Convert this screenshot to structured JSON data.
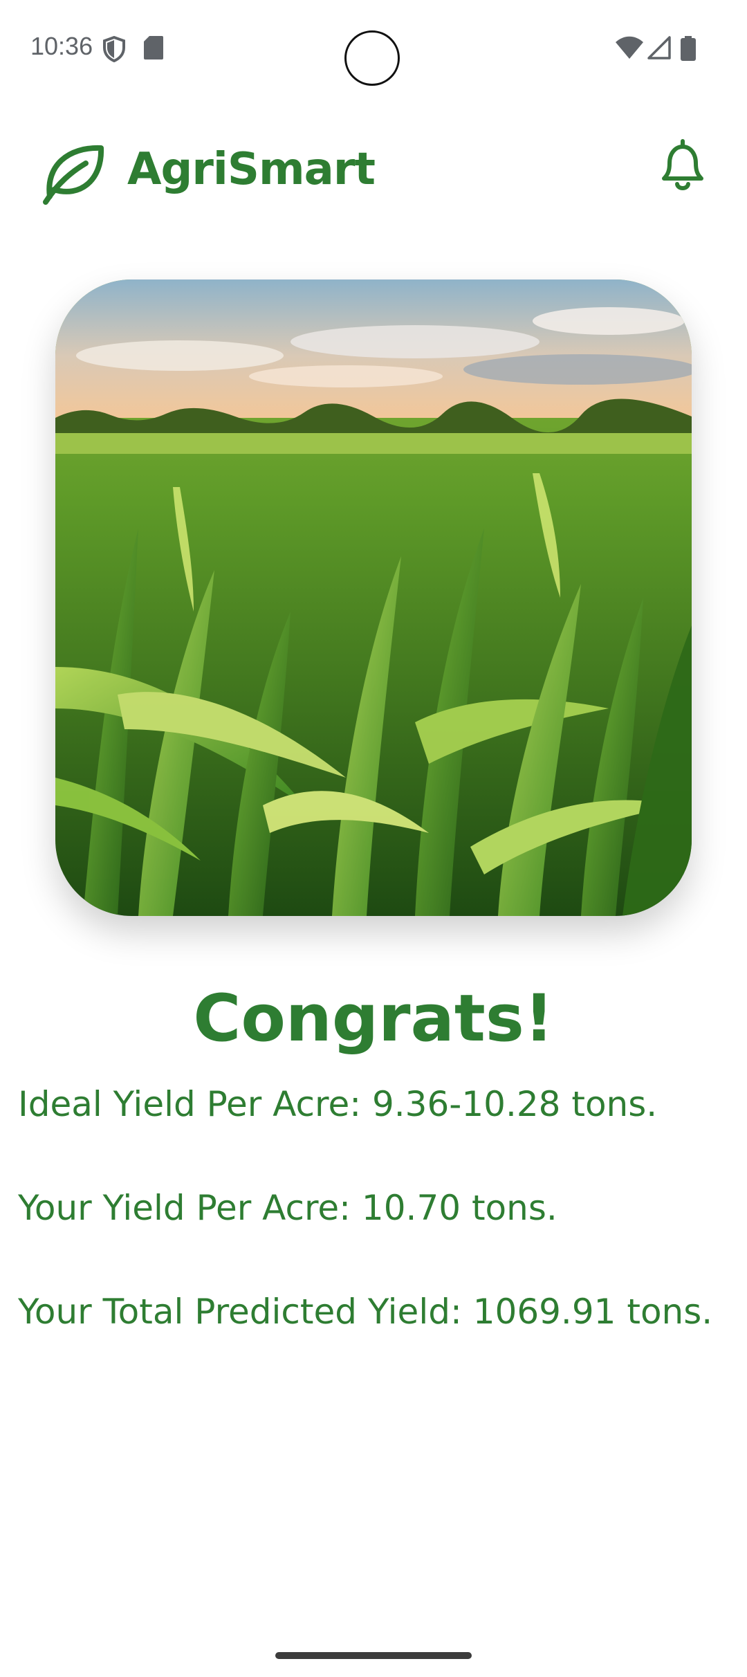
{
  "status_bar": {
    "time": "10:36"
  },
  "app_bar": {
    "title": "AgriSmart",
    "logo_icon": "leaf-icon",
    "notification_icon": "bell-icon"
  },
  "hero_image": {
    "icon": "corn-field-image"
  },
  "result": {
    "heading": "Congrats!",
    "ideal_yield": "Ideal Yield Per Acre: 9.36-10.28 tons.",
    "your_yield": "Your Yield Per Acre: 10.70 tons.",
    "total_yield": "Your Total Predicted Yield: 1069.91 tons."
  },
  "colors": {
    "primary": "#2e7d32",
    "background": "#ffffff"
  }
}
